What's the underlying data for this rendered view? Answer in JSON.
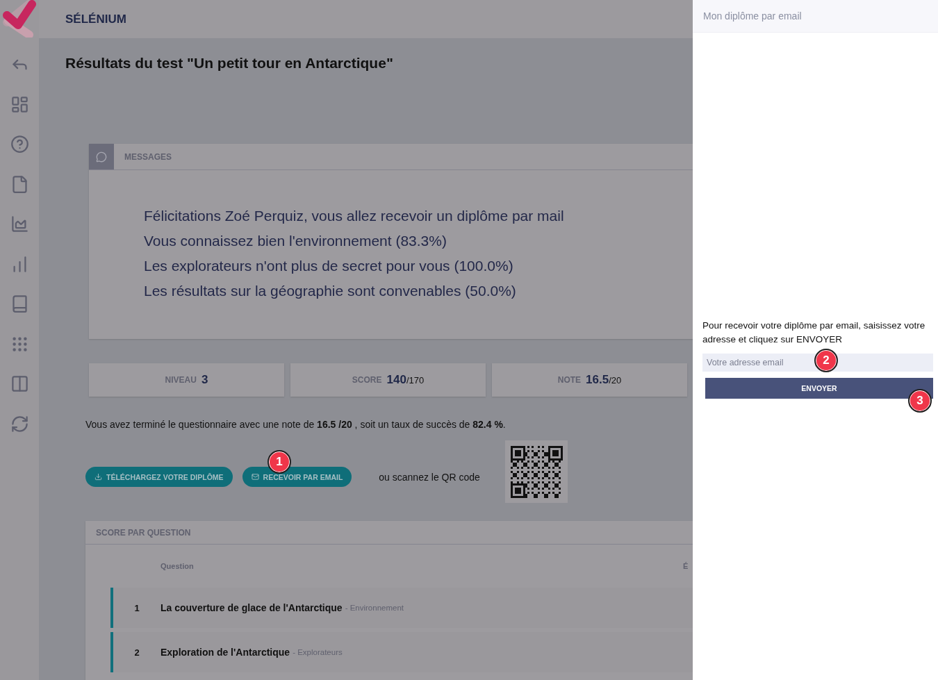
{
  "header": {
    "brand": "SÉLÉNIUM"
  },
  "page_title": "Résultats du test \"Un petit tour en Antarctique\"",
  "messages": {
    "title": "MESSAGES",
    "lines": [
      "Félicitations Zoé Perquiz, vous allez recevoir un diplôme par mail",
      "Vous connaissez bien l'environnement (83.3%)",
      "Les explorateurs n'ont plus de secret pour vous (100.0%)",
      "Les résultats sur la géographie sont convenables (50.0%)"
    ]
  },
  "stats": [
    {
      "label": "NIVEAU",
      "value": "3"
    },
    {
      "label": "SCORE",
      "value": "140",
      "total": "/170"
    },
    {
      "label": "NOTE",
      "value": "16.5",
      "total": "/20"
    }
  ],
  "summary": "Vous avez terminé le questionnaire avec une note de **16.5 /20** , soit un taux de succès de **82.4 %**.",
  "actions": {
    "buttons": [
      {
        "label": "TÉLÉCHARGEZ VOTRE DIPLÔME",
        "kind": "download"
      },
      {
        "label": "RECEVOIR PAR EMAIL",
        "kind": "email"
      }
    ],
    "qr_caption": "ou scannez le QR code"
  },
  "score_table": {
    "title": "SCORE PAR QUESTION",
    "columns": {
      "question": "Question",
      "column_3": "É"
    },
    "rows": [
      {
        "number": "1",
        "title": "La couverture de glace de l'Antarctique",
        "category": "- Environnement"
      },
      {
        "number": "2",
        "title": "Exploration de l'Antarctique",
        "category": "- Explorateurs"
      }
    ]
  },
  "drawer": {
    "title": "Mon diplôme par email",
    "instructions": "Pour recevoir votre diplôme par email, saisissez votre adresse et cliquez sur ENVOYER",
    "email_field": {
      "placeholder": "Votre adresse email"
    },
    "submit": "ENVOYER"
  },
  "annotations": [
    "1",
    "2",
    "3"
  ]
}
